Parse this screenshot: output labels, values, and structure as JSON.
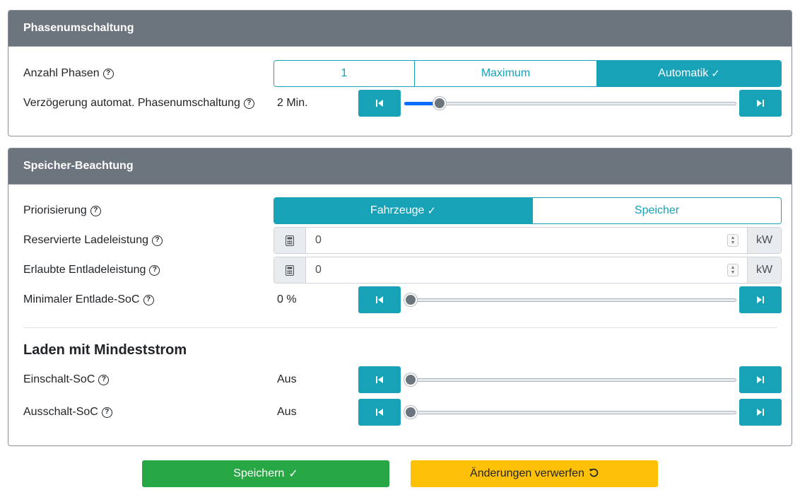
{
  "phase_card": {
    "title": "Phasenumschaltung",
    "anzahl_phasen": {
      "label": "Anzahl Phasen",
      "options": [
        "1",
        "Maximum",
        "Automatik"
      ],
      "selected": "Automatik"
    },
    "verzoegerung": {
      "label": "Verzögerung automat. Phasenumschaltung",
      "value": "2 Min.",
      "level": 0.09
    }
  },
  "storage_card": {
    "title": "Speicher-Beachtung",
    "priorisierung": {
      "label": "Priorisierung",
      "options": [
        "Fahrzeuge",
        "Speicher"
      ],
      "selected": "Fahrzeuge"
    },
    "reservierte": {
      "label": "Reservierte Ladeleistung",
      "value": "0",
      "unit": "kW"
    },
    "erlaubte": {
      "label": "Erlaubte Entladeleistung",
      "value": "0",
      "unit": "kW"
    },
    "min_soc": {
      "label": "Minimaler Entlade-SoC",
      "value": "0 %",
      "level": 0
    },
    "section_title": "Laden mit Mindeststrom",
    "einschalt": {
      "label": "Einschalt-SoC",
      "value": "Aus",
      "level": 0
    },
    "ausschalt": {
      "label": "Ausschalt-SoC",
      "value": "Aus",
      "level": 0
    }
  },
  "actions": {
    "save_label": "Speichern",
    "discard_label": "Änderungen verwerfen"
  },
  "colors": {
    "header": "#6c757d",
    "accent": "#17a2b8",
    "save": "#28a745",
    "discard": "#ffc107",
    "slider_fill": "#0d6efd"
  },
  "icons": {
    "help": "question-circle-icon",
    "calculator": "calculator-icon",
    "step_back": "step-backward-icon",
    "step_forward": "step-forward-icon",
    "check": "check-icon",
    "undo": "undo-icon"
  }
}
